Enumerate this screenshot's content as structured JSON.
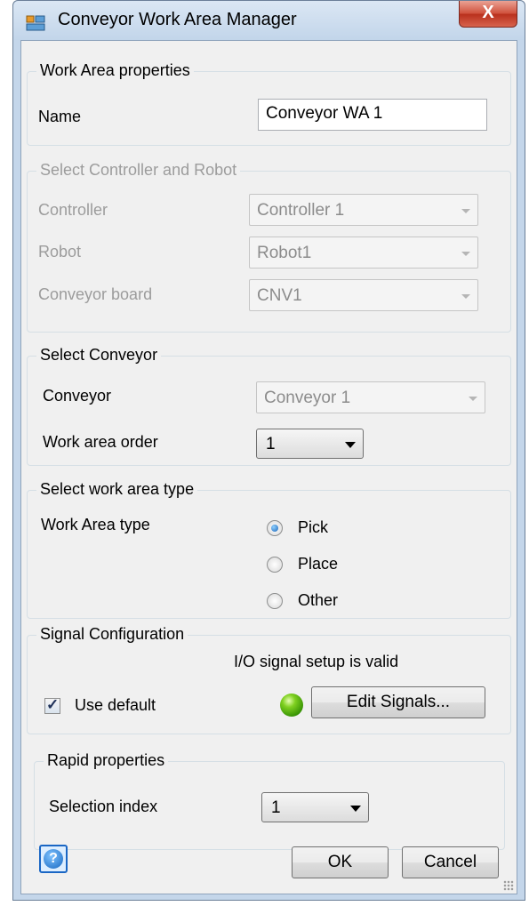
{
  "window": {
    "title": "Conveyor Work Area Manager",
    "close_label": "X"
  },
  "work_area": {
    "title": "Work Area properties",
    "name_label": "Name",
    "name_value": "Conveyor WA 1"
  },
  "controller_robot": {
    "title": "Select Controller and Robot",
    "controller_label": "Controller",
    "controller_value": "Controller 1",
    "robot_label": "Robot",
    "robot_value": "Robot1",
    "board_label": "Conveyor board",
    "board_value": "CNV1"
  },
  "conveyor": {
    "title": "Select Conveyor",
    "conveyor_label": "Conveyor",
    "conveyor_value": "Conveyor 1",
    "order_label": "Work area order",
    "order_value": "1"
  },
  "area_type": {
    "title": "Select work area type",
    "type_label": "Work Area type",
    "options": [
      "Pick",
      "Place",
      "Other"
    ],
    "selected": "Pick"
  },
  "signals": {
    "title": "Signal Configuration",
    "status_text": "I/O signal setup is valid",
    "use_default_label": "Use default",
    "use_default_checked": true,
    "edit_label": "Edit Signals...",
    "status_color": "#3fa800"
  },
  "rapid": {
    "title": "Rapid properties",
    "index_label": "Selection index",
    "index_value": "1"
  },
  "footer": {
    "ok_label": "OK",
    "cancel_label": "Cancel"
  }
}
